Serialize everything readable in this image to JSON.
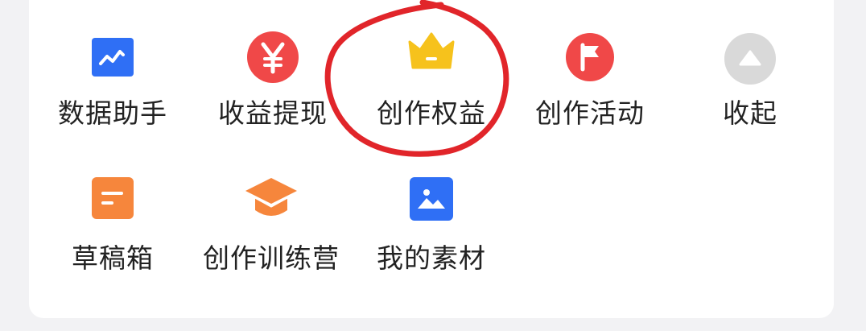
{
  "menu": {
    "items": [
      {
        "label": "数据助手",
        "icon": "chart-trend-icon",
        "color": "#2f6ff5"
      },
      {
        "label": "收益提现",
        "icon": "yen-icon",
        "color": "#f04848"
      },
      {
        "label": "创作权益",
        "icon": "crown-icon",
        "color": "#f6c21c"
      },
      {
        "label": "创作活动",
        "icon": "flag-icon",
        "color": "#f04848"
      },
      {
        "label": "收起",
        "icon": "collapse-icon",
        "color": "#d9d9d9"
      },
      {
        "label": "草稿箱",
        "icon": "draft-icon",
        "color": "#f6863c"
      },
      {
        "label": "创作训练营",
        "icon": "graduation-cap-icon",
        "color": "#f6863c"
      },
      {
        "label": "我的素材",
        "icon": "image-icon",
        "color": "#2f6ff5"
      }
    ]
  },
  "annotation": {
    "type": "hand-drawn-circle",
    "color": "#e1252a",
    "target": "创作权益"
  }
}
